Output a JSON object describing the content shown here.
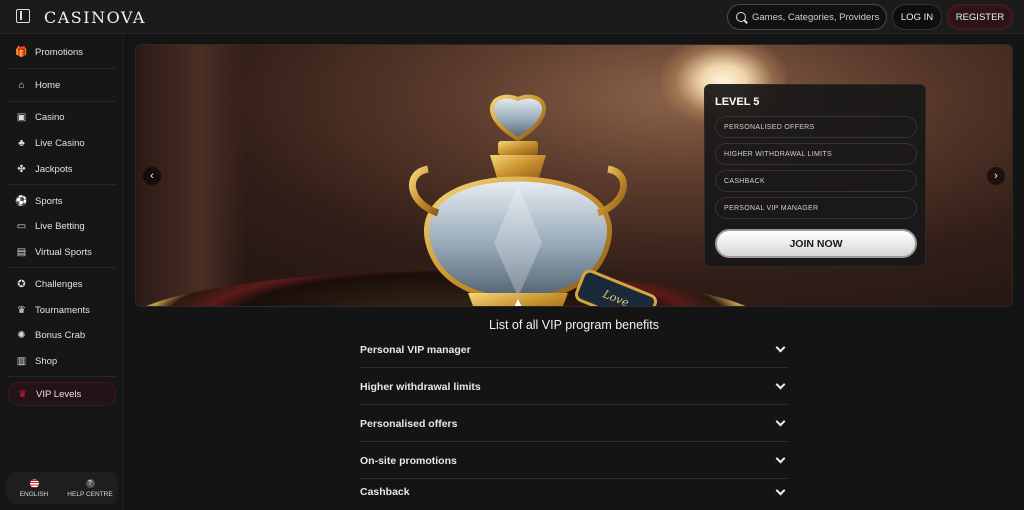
{
  "header": {
    "brand": "CASINOVA",
    "search_placeholder": "Games, Categories, Providers",
    "login_label": "LOG IN",
    "register_label": "REGISTER"
  },
  "sidebar": {
    "items": [
      {
        "label": "Promotions",
        "icon": "gift-icon"
      },
      {
        "label": "Home",
        "icon": "home-icon"
      },
      {
        "label": "Casino",
        "icon": "slot-machine-icon"
      },
      {
        "label": "Live Casino",
        "icon": "live-dealer-icon"
      },
      {
        "label": "Jackpots",
        "icon": "clover-icon"
      },
      {
        "label": "Sports",
        "icon": "soccer-ball-icon"
      },
      {
        "label": "Live Betting",
        "icon": "live-tv-icon"
      },
      {
        "label": "Virtual Sports",
        "icon": "virtual-sports-icon"
      },
      {
        "label": "Challenges",
        "icon": "medal-icon"
      },
      {
        "label": "Tournaments",
        "icon": "trophy-icon"
      },
      {
        "label": "Bonus Crab",
        "icon": "crab-icon"
      },
      {
        "label": "Shop",
        "icon": "shop-icon"
      },
      {
        "label": "VIP Levels",
        "icon": "crown-icon",
        "active": true
      }
    ],
    "footer": {
      "language_label": "ENGLISH",
      "help_label": "HELP CENTRE"
    }
  },
  "banner": {
    "tag_text": "Love",
    "level_card": {
      "title": "LEVEL 5",
      "perks": [
        "PERSONALISED OFFERS",
        "HIGHER WITHDRAWAL LIMITS",
        "CASHBACK",
        "PERSONAL VIP MANAGER"
      ],
      "cta_label": "JOIN NOW"
    }
  },
  "benefits": {
    "title": "List of all VIP program benefits",
    "items": [
      "Personal VIP manager",
      "Higher withdrawal limits",
      "Personalised offers",
      "On-site promotions",
      "Cashback"
    ]
  },
  "colors": {
    "accent_red": "#c2222f",
    "background": "#141414"
  }
}
